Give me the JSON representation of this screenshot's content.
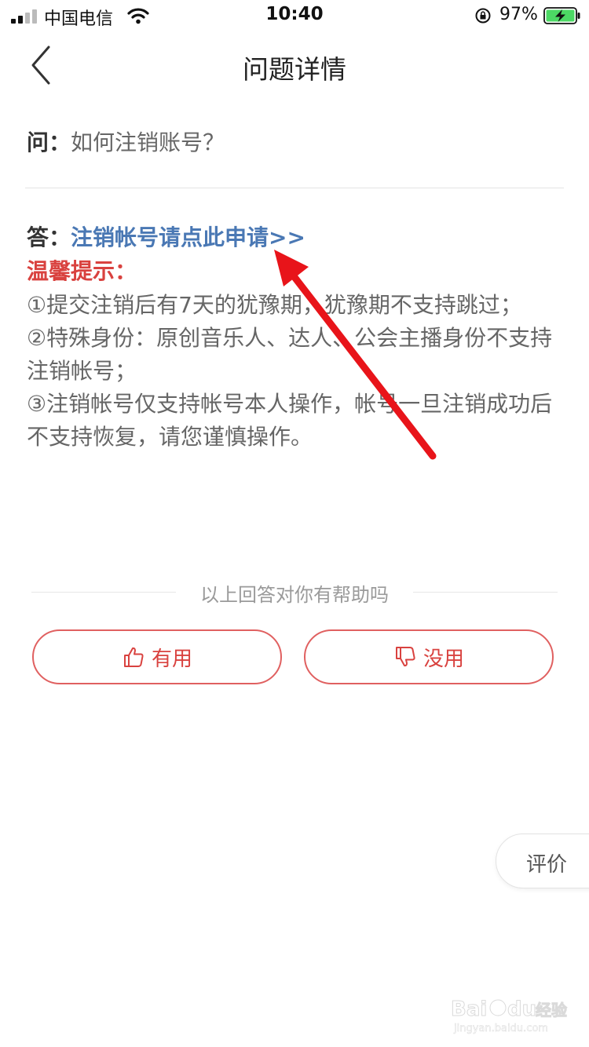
{
  "status_bar": {
    "carrier": "中国电信",
    "time": "10:40",
    "battery_percent": "97%",
    "icons": [
      "signal-icon",
      "wifi-icon",
      "rotation-lock-icon",
      "battery-charging-icon"
    ]
  },
  "nav": {
    "title": "问题详情",
    "back_icon": "chevron-left-icon"
  },
  "question": {
    "label": "问：",
    "text": "如何注销账号？"
  },
  "answer": {
    "label": "答：",
    "link_text": "注销帐号请点此申请>>",
    "tip_title": "温馨提示：",
    "tips": [
      "①提交注销后有7天的犹豫期，犹豫期不支持跳过；",
      "②特殊身份：原创音乐人、达人、公会主播身份不支持注销帐号；",
      "③注销帐号仅支持帐号本人操作，帐号一旦注销成功后不支持恢复，请您谨慎操作。"
    ]
  },
  "feedback": {
    "prompt": "以上回答对你有帮助吗",
    "useful_label": "有用",
    "useless_label": "没用",
    "useful_icon": "thumbs-up-icon",
    "useless_icon": "thumbs-down-icon"
  },
  "rate_button": {
    "label": "评价"
  },
  "watermark": {
    "brand": "Baidu经验",
    "url": "jingyan.baidu.com"
  },
  "colors": {
    "accent_red": "#d9423f",
    "link_blue": "#4a78b4",
    "arrow_red": "#e8141a"
  }
}
